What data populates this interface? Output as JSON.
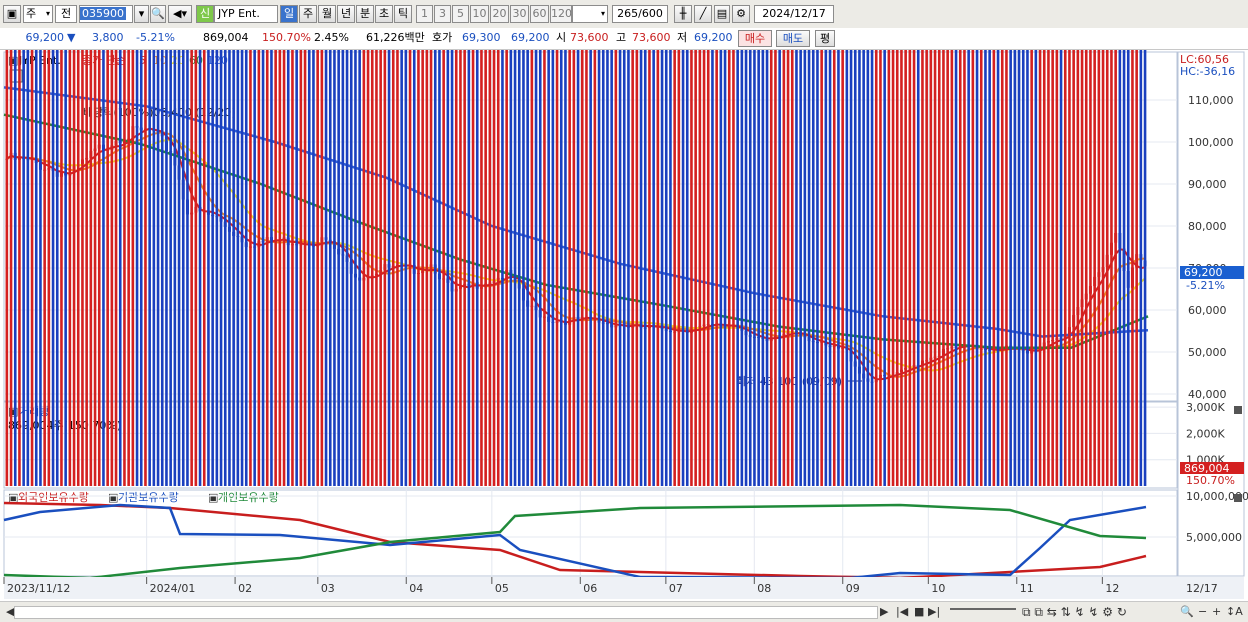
{
  "toolbar": {
    "market": "주",
    "prev_label": "전",
    "code": "035900",
    "market_tag": "신",
    "name": "JYP Ent.",
    "periods": [
      "일",
      "주",
      "월",
      "년",
      "분",
      "초",
      "틱"
    ],
    "active_period": "일",
    "steps": [
      "1",
      "3",
      "5",
      "10",
      "20",
      "30",
      "60",
      "120"
    ],
    "count": "265",
    "count_total": "/600",
    "date": "2024/12/17"
  },
  "quote": {
    "price": "69,200",
    "change_arrow": "▼",
    "change": "3,800",
    "change_pct": "-5.21%",
    "volume": "869,004",
    "vol_ratio": "150.70%",
    "turnover_rate": "2.45%",
    "amount": "61,226백만",
    "hoga_label": "호가",
    "hoga_ask": "69,300",
    "hoga_bid": "69,200",
    "open_label": "시",
    "open": "73,600",
    "high_label": "고",
    "high": "73,600",
    "low_label": "저",
    "low": "69,200",
    "buy_label": "매수",
    "sell_label": "매도",
    "eval_label": "평"
  },
  "price_panel": {
    "legend_name": "JYP Ent.",
    "legend_ma": "종가 단순",
    "ma_periods": [
      "5",
      "10",
      "20",
      "60",
      "120"
    ],
    "ma_colors": [
      "#d42020",
      "#f08a24",
      "#f5e22a",
      "#208a3a",
      "#3060d8"
    ],
    "lc": "LC:60,56",
    "hc": "HC:-36,16",
    "y_ticks": [
      "110,000",
      "100,000",
      "90,000",
      "80,000",
      "70,000",
      "60,000",
      "50,000",
      "40,000"
    ],
    "current_price_tag": "69,200",
    "current_change_tag": "-5.21%",
    "annot_high": "배당락(100%)08,400 (12/20)",
    "annot_low": "최저 43,100 (09/09)"
  },
  "volume_panel": {
    "title": "거래량",
    "current": "869,004주(150.70%)",
    "y_ticks": [
      "3,000K",
      "2,000K",
      "1,000K"
    ],
    "tag_value": "869,004",
    "tag_pct": "150.70%"
  },
  "holdings_panel": {
    "legend": [
      "외국인보유수량",
      "기관보유수량",
      "개인보유수량"
    ],
    "y_ticks": [
      "10,000,000",
      "5,000,000"
    ]
  },
  "x_axis": {
    "labels": [
      "2023/11/12",
      "2024/01",
      "02",
      "03",
      "04",
      "05",
      "06",
      "07",
      "08",
      "09",
      "10",
      "11",
      "12"
    ],
    "right_label": "12/17"
  },
  "chart_data": {
    "type": "line",
    "title": "",
    "x_range": [
      "2023/11/12",
      "2024/12/17"
    ],
    "y_range": [
      40000,
      115000
    ],
    "current": 69200,
    "annotations": [
      {
        "x": "2023/12/20",
        "y": 108400,
        "text": "배당락(100%)08,400 (12/20)"
      },
      {
        "x": "2024/09/09",
        "y": 43100,
        "text": "최저 43,100 (09/09)"
      }
    ],
    "close": [
      {
        "x": "2023/11/13",
        "y": 96000
      },
      {
        "x": "2023/11/25",
        "y": 94500
      },
      {
        "x": "2023/12/05",
        "y": 92000
      },
      {
        "x": "2023/12/14",
        "y": 97500
      },
      {
        "x": "2023/12/22",
        "y": 101500
      },
      {
        "x": "2024/01/02",
        "y": 102500
      },
      {
        "x": "2024/01/10",
        "y": 97500
      },
      {
        "x": "2024/01/15",
        "y": 84000
      },
      {
        "x": "2024/01/25",
        "y": 82000
      },
      {
        "x": "2024/02/05",
        "y": 76000
      },
      {
        "x": "2024/02/20",
        "y": 76500
      },
      {
        "x": "2024/03/04",
        "y": 76500
      },
      {
        "x": "2024/03/15",
        "y": 68000
      },
      {
        "x": "2024/03/25",
        "y": 70000
      },
      {
        "x": "2024/04/03",
        "y": 69500
      },
      {
        "x": "2024/04/10",
        "y": 71000
      },
      {
        "x": "2024/04/17",
        "y": 64000
      },
      {
        "x": "2024/04/27",
        "y": 66500
      },
      {
        "x": "2024/05/07",
        "y": 68500
      },
      {
        "x": "2024/05/13",
        "y": 61000
      },
      {
        "x": "2024/05/22",
        "y": 57500
      },
      {
        "x": "2024/06/05",
        "y": 57500
      },
      {
        "x": "2024/06/25",
        "y": 55500
      },
      {
        "x": "2024/07/10",
        "y": 55500
      },
      {
        "x": "2024/07/25",
        "y": 56500
      },
      {
        "x": "2024/08/05",
        "y": 52000
      },
      {
        "x": "2024/08/15",
        "y": 55500
      },
      {
        "x": "2024/08/26",
        "y": 51000
      },
      {
        "x": "2024/09/02",
        "y": 50500
      },
      {
        "x": "2024/09/09",
        "y": 43100
      },
      {
        "x": "2024/09/20",
        "y": 44500
      },
      {
        "x": "2024/09/30",
        "y": 48500
      },
      {
        "x": "2024/10/10",
        "y": 51000
      },
      {
        "x": "2024/10/20",
        "y": 51000
      },
      {
        "x": "2024/10/28",
        "y": 51000
      },
      {
        "x": "2024/11/05",
        "y": 49500
      },
      {
        "x": "2024/11/12",
        "y": 53000
      },
      {
        "x": "2024/11/18",
        "y": 54000
      },
      {
        "x": "2024/11/25",
        "y": 63000
      },
      {
        "x": "2024/12/02",
        "y": 72500
      },
      {
        "x": "2024/12/06",
        "y": 79000
      },
      {
        "x": "2024/12/10",
        "y": 66000
      },
      {
        "x": "2024/12/13",
        "y": 72500
      },
      {
        "x": "2024/12/17",
        "y": 69200
      }
    ],
    "ma60": [
      {
        "x": "2023/11/12",
        "y": 106500
      },
      {
        "x": "2023/12/30",
        "y": 99500
      },
      {
        "x": "2024/02/10",
        "y": 90000
      },
      {
        "x": "2024/03/15",
        "y": 81000
      },
      {
        "x": "2024/04/20",
        "y": 72000
      },
      {
        "x": "2024/05/20",
        "y": 66000
      },
      {
        "x": "2024/07/01",
        "y": 61000
      },
      {
        "x": "2024/08/10",
        "y": 56000
      },
      {
        "x": "2024/09/15",
        "y": 53000
      },
      {
        "x": "2024/10/25",
        "y": 51000
      },
      {
        "x": "2024/11/20",
        "y": 51000
      },
      {
        "x": "2024/12/17",
        "y": 58500
      }
    ],
    "ma120": [
      {
        "x": "2023/11/12",
        "y": 113000
      },
      {
        "x": "2024/01/01",
        "y": 108500
      },
      {
        "x": "2024/02/15",
        "y": 100000
      },
      {
        "x": "2024/03/25",
        "y": 91500
      },
      {
        "x": "2024/05/01",
        "y": 80000
      },
      {
        "x": "2024/06/15",
        "y": 71000
      },
      {
        "x": "2024/08/01",
        "y": 64000
      },
      {
        "x": "2024/09/15",
        "y": 58500
      },
      {
        "x": "2024/10/25",
        "y": 55500
      },
      {
        "x": "2024/11/10",
        "y": 53700
      },
      {
        "x": "2024/12/17",
        "y": 55200
      }
    ]
  }
}
